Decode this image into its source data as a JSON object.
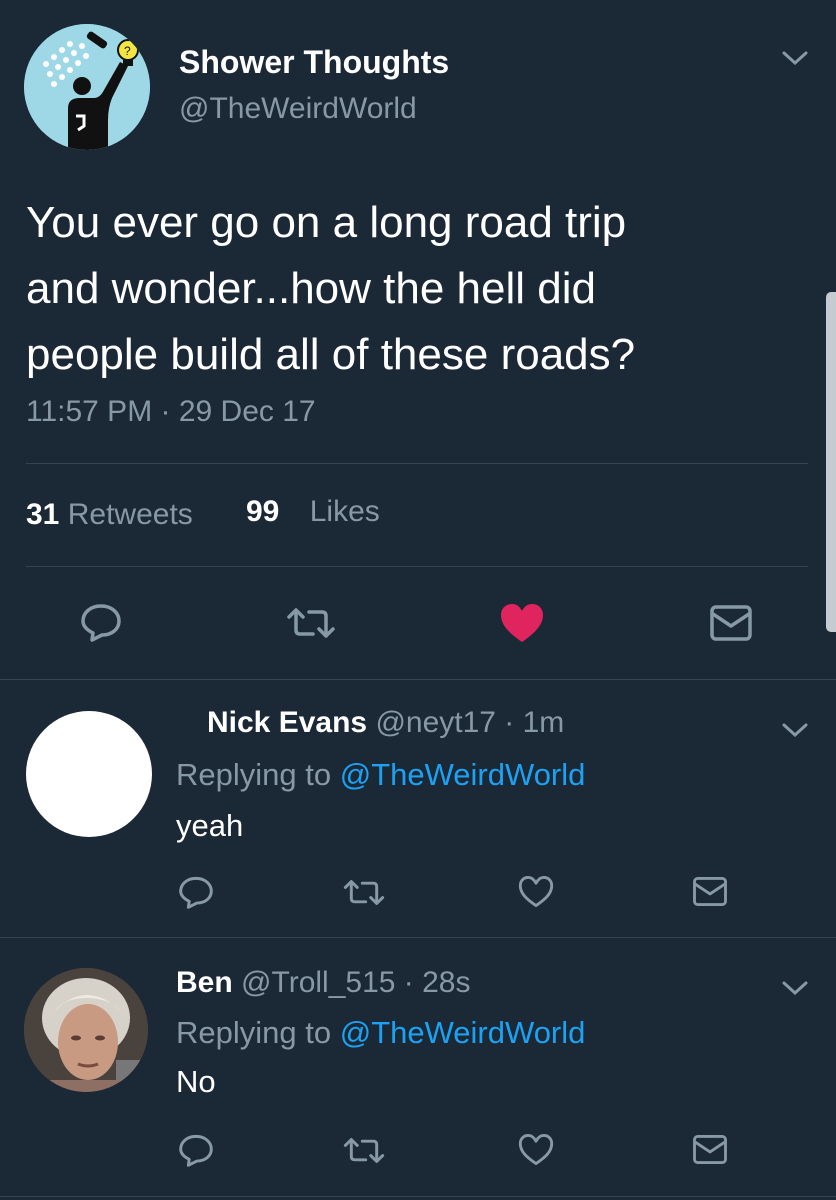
{
  "main_tweet": {
    "display_name": "Shower Thoughts",
    "handle": "@TheWeirdWorld",
    "text_lines": [
      "You ever go on a long road trip",
      "and wonder...how the hell did",
      "people build all of these roads?"
    ],
    "timestamp": "11:57 PM · 29 Dec 17",
    "retweet_count": "31",
    "retweet_label": "Retweets",
    "like_count": "99",
    "like_label": "Likes",
    "liked": true,
    "like_color": "#e0245e"
  },
  "replies": [
    {
      "display_name": "Nick Evans",
      "meta": "@neyt17 · 1m",
      "replying_prefix": "Replying to",
      "replying_to": "@TheWeirdWorld",
      "text": "yeah"
    },
    {
      "display_name": "Ben",
      "meta": "@Troll_515 · 28s",
      "replying_prefix": "Replying to",
      "replying_to": "@TheWeirdWorld",
      "text": "No"
    }
  ],
  "icons": [
    "reply-icon",
    "retweet-icon",
    "like-icon",
    "message-icon",
    "chevron-down-icon"
  ],
  "colors": {
    "background": "#1b2836",
    "muted": "#8899a6",
    "link": "#1da1f2",
    "divider": "#38444d"
  }
}
